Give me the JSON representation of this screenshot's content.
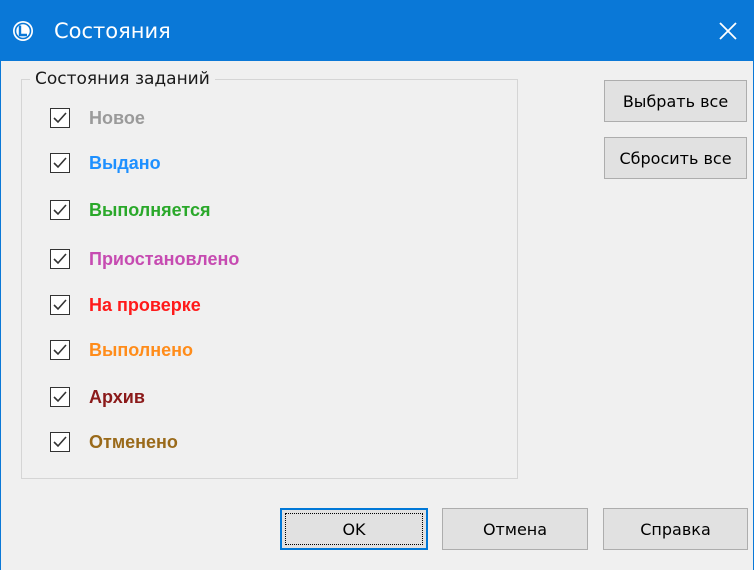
{
  "window": {
    "title": "Состояния",
    "app_icon": "app-logo-icon",
    "close_icon": "close-icon"
  },
  "group": {
    "title": "Состояния заданий",
    "statuses": [
      {
        "label": "Новое",
        "checked": true,
        "color": "#9a9a9a"
      },
      {
        "label": "Выдано",
        "checked": true,
        "color": "#1e90ff"
      },
      {
        "label": "Выполняется",
        "checked": true,
        "color": "#2aa82a"
      },
      {
        "label": "Приостановлено",
        "checked": true,
        "color": "#c64bb1"
      },
      {
        "label": "На проверке",
        "checked": true,
        "color": "#ff1a1a"
      },
      {
        "label": "Выполнено",
        "checked": true,
        "color": "#ff8c1a"
      },
      {
        "label": "Архив",
        "checked": true,
        "color": "#8b1a1a"
      },
      {
        "label": "Отменено",
        "checked": true,
        "color": "#9a6a1a"
      }
    ]
  },
  "side_buttons": {
    "select_all": "Выбрать все",
    "reset_all": "Сбросить все"
  },
  "footer_buttons": {
    "ok": "OK",
    "cancel": "Отмена",
    "help": "Справка"
  },
  "colors": {
    "titlebar": "#0a78d7",
    "dialog_bg": "#f0f0f0",
    "button_bg": "#e1e1e1"
  }
}
